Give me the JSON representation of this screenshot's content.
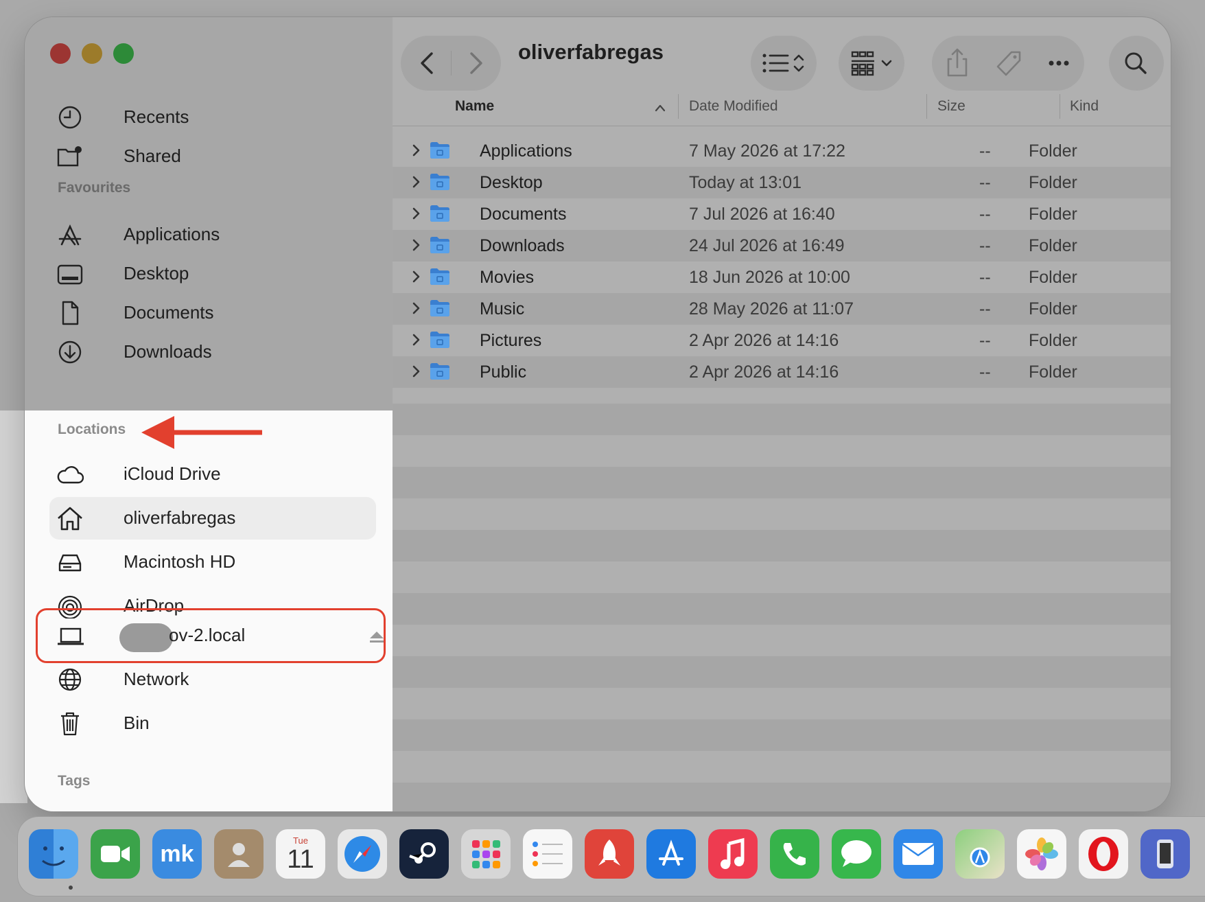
{
  "window": {
    "title": "oliverfabregas"
  },
  "sidebar": {
    "items_top": [
      {
        "label": "Recents",
        "icon": "clock-icon"
      },
      {
        "label": "Shared",
        "icon": "shared-folder-icon"
      }
    ],
    "favourites_heading": "Favourites",
    "favourites": [
      {
        "label": "Applications",
        "icon": "applications-icon"
      },
      {
        "label": "Desktop",
        "icon": "desktop-icon"
      },
      {
        "label": "Documents",
        "icon": "document-icon"
      },
      {
        "label": "Downloads",
        "icon": "download-icon"
      }
    ],
    "locations_heading": "Locations",
    "locations": [
      {
        "label": "iCloud Drive",
        "icon": "cloud-icon"
      },
      {
        "label": "oliverfabregas",
        "icon": "home-icon",
        "selected": true
      },
      {
        "label": "Macintosh HD",
        "icon": "drive-icon"
      },
      {
        "label": "AirDrop",
        "icon": "airdrop-icon"
      },
      {
        "label": "ov-2.local",
        "icon": "laptop-icon"
      },
      {
        "label": "Network",
        "icon": "globe-icon"
      },
      {
        "label": "Bin",
        "icon": "trash-icon"
      }
    ],
    "tags_heading": "Tags"
  },
  "columns": {
    "name": "Name",
    "date": "Date Modified",
    "size": "Size",
    "kind": "Kind"
  },
  "files": [
    {
      "name": "Applications",
      "date": "7 May 2026 at 17:22",
      "size": "--",
      "kind": "Folder"
    },
    {
      "name": "Desktop",
      "date": "Today at 13:01",
      "size": "--",
      "kind": "Folder"
    },
    {
      "name": "Documents",
      "date": "7 Jul 2026 at 16:40",
      "size": "--",
      "kind": "Folder"
    },
    {
      "name": "Downloads",
      "date": "24 Jul 2026 at 16:49",
      "size": "--",
      "kind": "Folder"
    },
    {
      "name": "Movies",
      "date": "18 Jun 2026 at 10:00",
      "size": "--",
      "kind": "Folder"
    },
    {
      "name": "Music",
      "date": "28 May 2026 at 11:07",
      "size": "--",
      "kind": "Folder"
    },
    {
      "name": "Pictures",
      "date": "2 Apr 2026 at 14:16",
      "size": "--",
      "kind": "Folder"
    },
    {
      "name": "Public",
      "date": "2 Apr 2026 at 14:16",
      "size": "--",
      "kind": "Folder"
    }
  ],
  "dock": {
    "calendar_day": "Tue",
    "calendar_date": "11",
    "apps": [
      "finder",
      "facetime",
      "mk",
      "contacts",
      "calendar",
      "safari",
      "steam",
      "launchpad",
      "reminders",
      "rocket",
      "app-store",
      "music",
      "phone",
      "messages",
      "mail",
      "maps",
      "photos",
      "opera",
      "simulator"
    ]
  },
  "colors": {
    "annotation": "#e2402e",
    "accent": "#3a8be0"
  }
}
